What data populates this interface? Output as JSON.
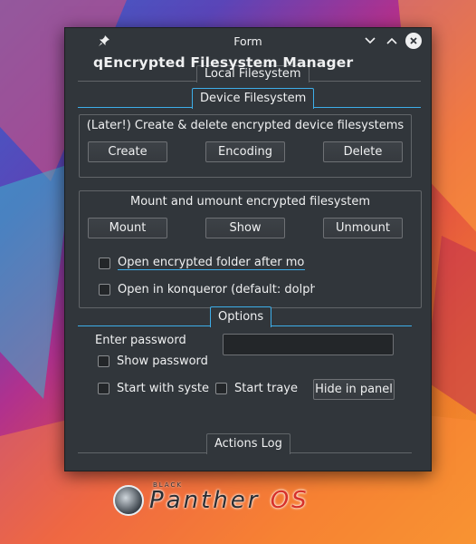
{
  "window": {
    "title": "Form",
    "app_title": "qEncrypted Filesystem Manager"
  },
  "sections": {
    "local": "Local Filesystem",
    "device": "Device Filesystem",
    "options": "Options",
    "log": "Actions Log"
  },
  "device_group": {
    "title": "(Later!) Create & delete encrypted device filesystems",
    "buttons": [
      "Create",
      "Encoding",
      "Delete"
    ]
  },
  "mount_group": {
    "title": "Mount and umount encrypted filesystem",
    "buttons": [
      "Mount",
      "Show",
      "Unmount"
    ],
    "open_folder": "Open encrypted folder after mour",
    "open_konqueror": "Open in konqueror (default: dolphin"
  },
  "options": {
    "password_label": "Enter password",
    "password_value": "",
    "show_password": "Show password",
    "start_with_system": "Start with syste",
    "start_tray": "Start traye",
    "hide_in_panel": "Hide in panel"
  },
  "checkbox_states": {
    "open_folder": false,
    "open_konqueror": false,
    "show_password": false,
    "start_with_system": false,
    "start_tray": false
  },
  "wallpaper_logo": {
    "brand": "BLACK",
    "wordmark": "Panther",
    "os": "OS"
  },
  "icons": [
    "pin-icon",
    "minimize-icon",
    "maximize-icon",
    "close-icon",
    "panther-emblem-icon"
  ]
}
